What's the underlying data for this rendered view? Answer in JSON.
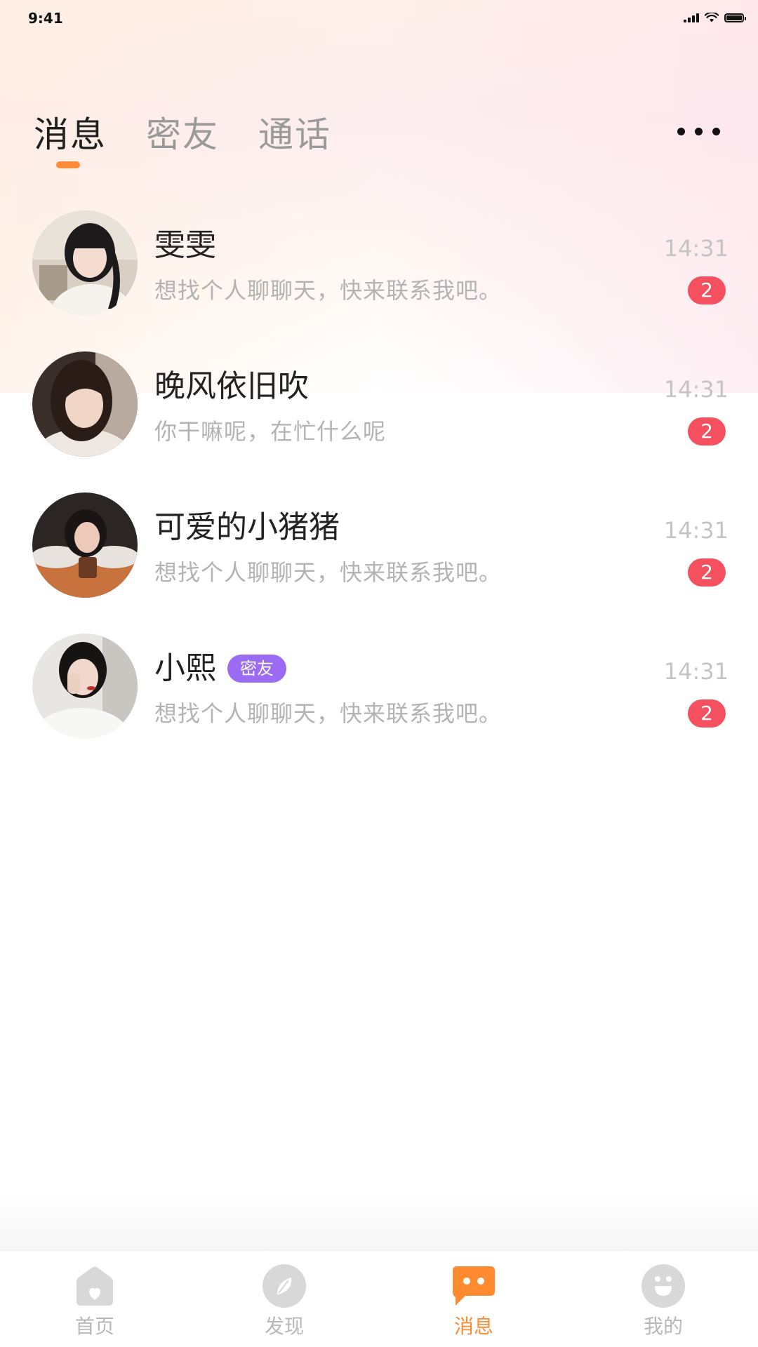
{
  "status_bar": {
    "time": "9:41"
  },
  "tabs": [
    {
      "label": "消息",
      "active": true
    },
    {
      "label": "密友",
      "active": false
    },
    {
      "label": "通话",
      "active": false
    }
  ],
  "more_icon": "more-dots-icon",
  "chats": [
    {
      "name": "雯雯",
      "tag": "",
      "preview": "想找个人聊聊天，快来联系我吧。",
      "time": "14:31",
      "unread": "2"
    },
    {
      "name": "晚风依旧吹",
      "tag": "",
      "preview": "你干嘛呢，在忙什么呢",
      "time": "14:31",
      "unread": "2"
    },
    {
      "name": "可爱的小猪猪",
      "tag": "",
      "preview": "想找个人聊聊天，快来联系我吧。",
      "time": "14:31",
      "unread": "2"
    },
    {
      "name": "小熙",
      "tag": "密友",
      "preview": "想找个人聊聊天，快来联系我吧。",
      "time": "14:31",
      "unread": "2"
    }
  ],
  "tabbar": [
    {
      "label": "首页",
      "icon": "home-icon",
      "active": false
    },
    {
      "label": "发现",
      "icon": "compass-icon",
      "active": false
    },
    {
      "label": "消息",
      "icon": "chat-bubble-icon",
      "active": true
    },
    {
      "label": "我的",
      "icon": "smiley-icon",
      "active": false
    }
  ],
  "colors": {
    "accent": "#ff8c3a",
    "badge": "#f4505f",
    "tag": "#9b6cf3",
    "inactive_icon": "#d6d6d6"
  }
}
